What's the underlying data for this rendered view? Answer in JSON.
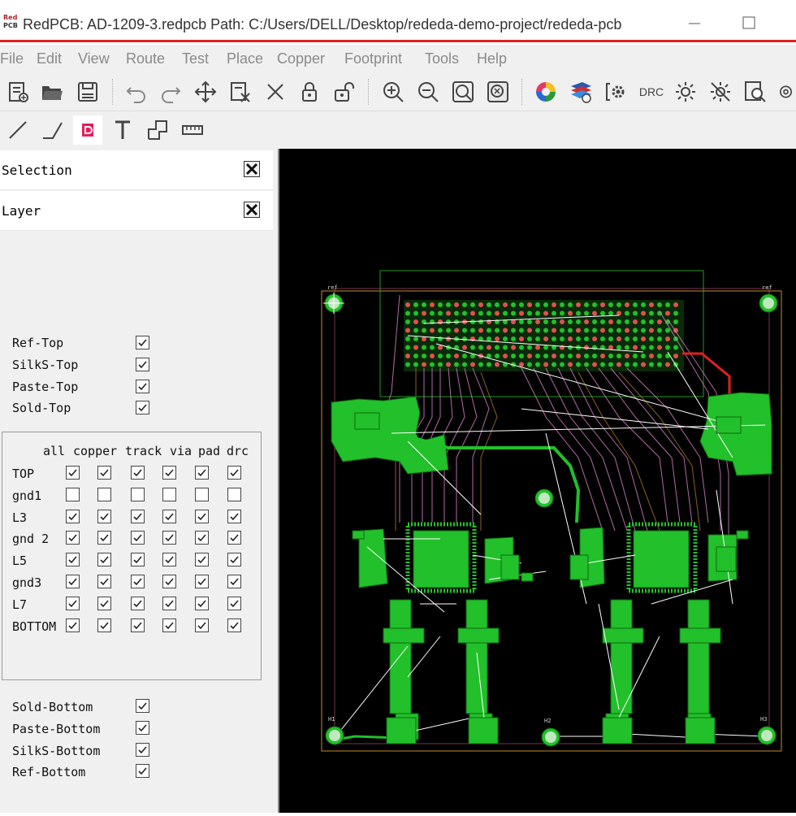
{
  "window": {
    "title": "RedPCB: AD-1209-3.redpcb Path: C:/Users/DELL/Desktop/rededa-demo-project/rededa-pcb"
  },
  "menu": [
    "File",
    "Edit",
    "View",
    "Route",
    "Test",
    "Place",
    "Copper",
    "Footprint",
    "Tools",
    "Help"
  ],
  "toolbar": {
    "drc_label": "DRC"
  },
  "docks": {
    "selection": "Selection",
    "layer": "Layer"
  },
  "top_layers": [
    {
      "name": "Ref-Top",
      "checked": true
    },
    {
      "name": "SilkS-Top",
      "checked": true
    },
    {
      "name": "Paste-Top",
      "checked": true
    },
    {
      "name": "Sold-Top",
      "checked": true
    }
  ],
  "layer_table": {
    "columns": [
      "all",
      "copper",
      "track",
      "via",
      "pad",
      "drc"
    ],
    "rows": [
      {
        "name": "TOP",
        "checks": [
          true,
          true,
          true,
          true,
          true,
          true
        ]
      },
      {
        "name": "gnd1",
        "checks": [
          false,
          false,
          false,
          false,
          false,
          false
        ]
      },
      {
        "name": "L3",
        "checks": [
          true,
          true,
          true,
          true,
          true,
          true
        ]
      },
      {
        "name": "gnd 2",
        "checks": [
          true,
          true,
          true,
          true,
          true,
          true
        ]
      },
      {
        "name": "L5",
        "checks": [
          true,
          true,
          true,
          true,
          true,
          true
        ]
      },
      {
        "name": "gnd3",
        "checks": [
          true,
          true,
          true,
          true,
          true,
          true
        ]
      },
      {
        "name": "L7",
        "checks": [
          true,
          true,
          true,
          true,
          true,
          true
        ]
      },
      {
        "name": "BOTTOM",
        "checks": [
          true,
          true,
          true,
          true,
          true,
          true
        ]
      }
    ]
  },
  "bottom_layers": [
    {
      "name": "Sold-Bottom",
      "checked": true
    },
    {
      "name": "Paste-Bottom",
      "checked": true
    },
    {
      "name": "SilkS-Bottom",
      "checked": true
    },
    {
      "name": "Ref-Bottom",
      "checked": true
    }
  ],
  "colors": {
    "copper_top": "#22c02a",
    "board_outline": "#c88a2a",
    "track_pink": "#d080c0",
    "ratsnest": "#ffffff",
    "highlight": "#e02020",
    "canvas_bg": "#000000"
  },
  "board_labels": {
    "mounting_holes": [
      "ref",
      "ref",
      "H1",
      "H2",
      "H3"
    ]
  }
}
